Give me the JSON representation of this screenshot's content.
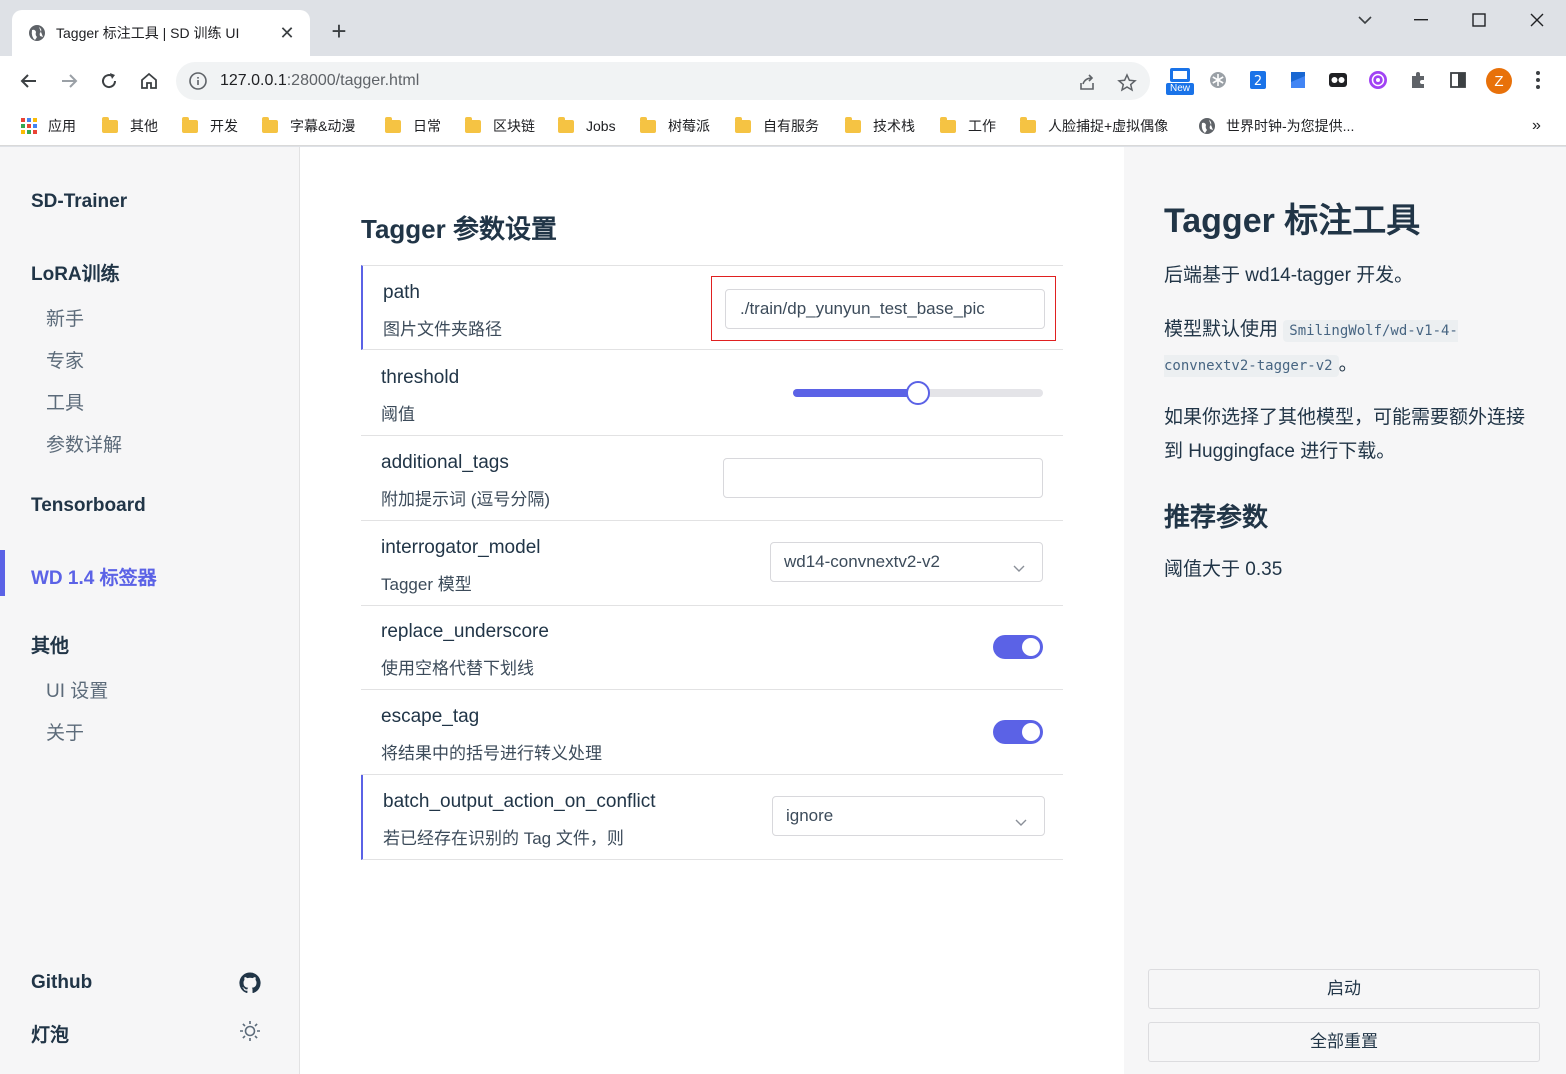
{
  "browser": {
    "tab_title": "Tagger 标注工具 | SD 训练 UI",
    "url_host": "127.0.0.1",
    "url_path": ":28000/tagger.html",
    "profile_initial": "Z",
    "new_badge": "New",
    "bookmarks_overflow": "»",
    "bookmarks": [
      "应用",
      "其他",
      "开发",
      "字幕&动漫",
      "日常",
      "区块链",
      "Jobs",
      "树莓派",
      "自有服务",
      "技术栈",
      "工作",
      "人脸捕捉+虚拟偶像",
      "世界时钟-为您提供..."
    ]
  },
  "sidebar": {
    "brand": "SD-Trainer",
    "lora_group": "LoRA训练",
    "lora_items": [
      "新手",
      "专家",
      "工具",
      "参数详解"
    ],
    "tensorboard": "Tensorboard",
    "wd_tagger": "WD 1.4 标签器",
    "other_group": "其他",
    "other_items": [
      "UI 设置",
      "关于"
    ],
    "github": "Github",
    "theme": "灯泡"
  },
  "main": {
    "title": "Tagger 参数设置",
    "params": [
      {
        "name": "path",
        "desc": "图片文件夹路径",
        "value": "./train/dp_yunyun_test_base_pic"
      },
      {
        "name": "threshold",
        "desc": "阈值",
        "value": 0.5
      },
      {
        "name": "additional_tags",
        "desc": "附加提示词 (逗号分隔)",
        "value": ""
      },
      {
        "name": "interrogator_model",
        "desc": "Tagger 模型",
        "value": "wd14-convnextv2-v2"
      },
      {
        "name": "replace_underscore",
        "desc": "使用空格代替下划线",
        "value": true
      },
      {
        "name": "escape_tag",
        "desc": "将结果中的括号进行转义处理",
        "value": true
      },
      {
        "name": "batch_output_action_on_conflict",
        "desc": "若已经存在识别的 Tag 文件，则",
        "value": "ignore"
      }
    ]
  },
  "aside": {
    "title": "Tagger 标注工具",
    "p1": "后端基于 wd14-tagger 开发。",
    "p2_prefix": "模型默认使用 ",
    "p2_code": "SmilingWolf/wd-v1-4-convnextv2-tagger-v2",
    "p2_suffix": "。",
    "p3": "如果你选择了其他模型，可能需要额外连接到 Huggingface 进行下载。",
    "h2": "推荐参数",
    "p4": "阈值大于 0.35",
    "start_button": "启动",
    "reset_button": "全部重置"
  },
  "colors": {
    "accent": "#5b62e6",
    "highlight_outline": "#e02020"
  }
}
